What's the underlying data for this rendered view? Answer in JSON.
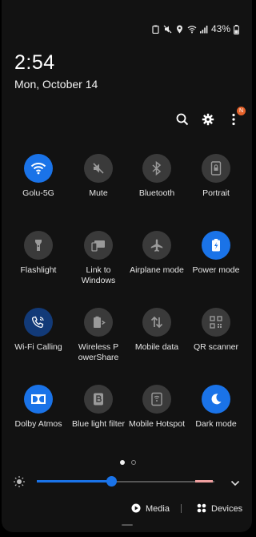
{
  "status": {
    "battery": "43%"
  },
  "clock": {
    "time": "2:54",
    "date": "Mon, October 14"
  },
  "notification_badge": "N",
  "tiles": [
    {
      "label": "Golu-5G",
      "icon": "wifi-icon",
      "state": "on"
    },
    {
      "label": "Mute",
      "icon": "mute-icon",
      "state": "off"
    },
    {
      "label": "Bluetooth",
      "icon": "bluetooth-icon",
      "state": "off"
    },
    {
      "label": "Portrait",
      "icon": "portrait-lock-icon",
      "state": "off"
    },
    {
      "label": "Flashlight",
      "icon": "flashlight-icon",
      "state": "off"
    },
    {
      "label": "Link to Windows",
      "icon": "link-to-windows-icon",
      "state": "off"
    },
    {
      "label": "Airplane mode",
      "icon": "airplane-icon",
      "state": "off"
    },
    {
      "label": "Power mode",
      "icon": "power-mode-icon",
      "state": "on"
    },
    {
      "label": "Wi-Fi Calling",
      "icon": "wifi-calling-icon",
      "state": "dim"
    },
    {
      "label": "Wireless P owerShare",
      "icon": "wireless-powershare-icon",
      "state": "off"
    },
    {
      "label": "Mobile data",
      "icon": "mobile-data-icon",
      "state": "off"
    },
    {
      "label": "QR scanner",
      "icon": "qr-scanner-icon",
      "state": "off"
    },
    {
      "label": "Dolby Atmos",
      "icon": "dolby-icon",
      "state": "on"
    },
    {
      "label": "Blue light filter",
      "icon": "blue-light-filter-icon",
      "state": "off"
    },
    {
      "label": "Mobile Hotspot",
      "icon": "hotspot-icon",
      "state": "off"
    },
    {
      "label": "Dark mode",
      "icon": "dark-mode-icon",
      "state": "on"
    }
  ],
  "pager": {
    "pages": 2,
    "active": 1
  },
  "brightness": {
    "level": 0.42
  },
  "bottom": {
    "media_label": "Media",
    "devices_label": "Devices"
  },
  "colors": {
    "accent": "#1a73e8",
    "tile_off": "#3a3a3a",
    "badge": "#e5622a"
  }
}
